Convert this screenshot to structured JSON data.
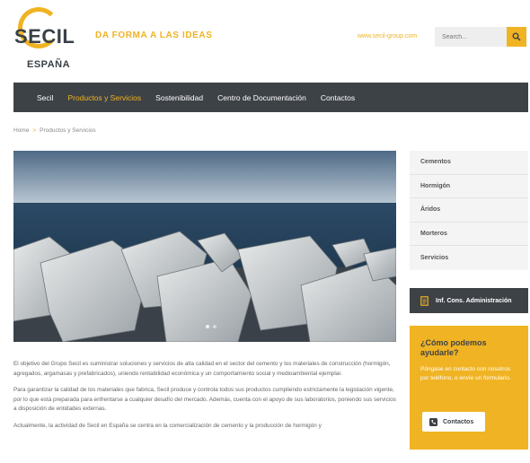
{
  "header": {
    "logo_word": "SECIL",
    "logo_country": "ESPAÑA",
    "tagline": "DA FORMA A LAS IDEAS",
    "site_link": "www.secil-group.com",
    "search_placeholder": "Search..."
  },
  "nav": {
    "items": [
      {
        "label": "Secil"
      },
      {
        "label": "Productos y Servicios",
        "active": true
      },
      {
        "label": "Sostenibilidad"
      },
      {
        "label": "Centro de Documentación"
      },
      {
        "label": "Contactos"
      }
    ]
  },
  "breadcrumb": {
    "home": "Home",
    "separator": ">",
    "current": "Productos y Servicios"
  },
  "content": {
    "paragraphs": [
      "El objetivo del Grupo Secil es suministrar soluciones y servicios de alta calidad en el sector del cemento y los materiales de construcción (hormigón, agregados, argamasas y prefabricados), uniendo rentabilidad económica y un comportamiento social y medioambiental ejemplar.",
      "Para garantizar la calidad de los materiales que fabrica, Secil produce y controla todos sus productos cumpliendo estrictamente la legislación vigente, por lo que está preparada para enfrentarse a cualquier desafío del mercado. Además, cuenta con el apoyo de sus laboratorios, poniendo sus servicios a disposición de entidades externas.",
      "Actualmente, la actividad de Secil en España se centra en la comercialización de cemento y la producción de hormigón y"
    ]
  },
  "sidebar": {
    "menu": [
      "Cementos",
      "Hormigón",
      "Áridos",
      "Morteros",
      "Servicios"
    ],
    "admin_button": "Inf. Cons. Administración",
    "help": {
      "title": "¿Cómo podemos ayudarle?",
      "text": "Póngase en contacto con nosotros por teléfono, o envíe un formulario.",
      "button": "Contactos"
    }
  },
  "colors": {
    "accent": "#f0b323",
    "dark": "#3d4247"
  }
}
